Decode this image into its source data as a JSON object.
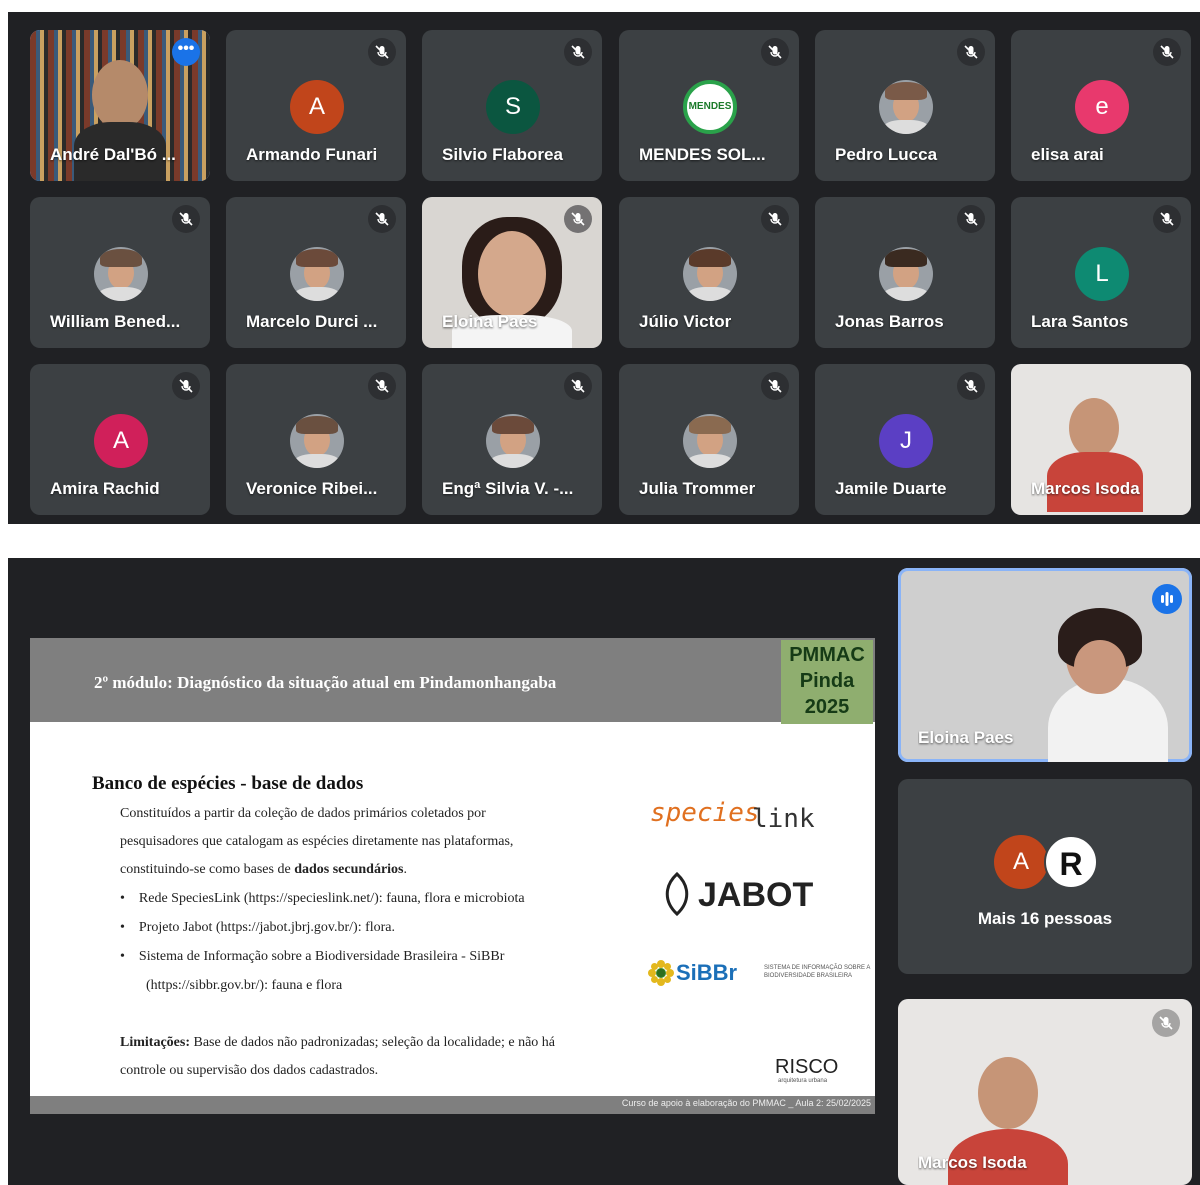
{
  "grid": {
    "tiles": [
      {
        "name": "André Dal'Bó ...",
        "type": "video",
        "active": true
      },
      {
        "name": "Armando Funari",
        "type": "avatar",
        "initial": "A",
        "color": "#c1451b"
      },
      {
        "name": "Silvio Flaborea",
        "type": "avatar",
        "initial": "S",
        "color": "#0b5640"
      },
      {
        "name": "MENDES SOL...",
        "type": "logo",
        "logo_text": "MENDES"
      },
      {
        "name": "Pedro Lucca",
        "type": "photo"
      },
      {
        "name": "elisa arai",
        "type": "avatar",
        "initial": "e",
        "color": "#e8396d"
      },
      {
        "name": "William Bened...",
        "type": "photo"
      },
      {
        "name": "Marcelo Durci ...",
        "type": "photo"
      },
      {
        "name": "Eloina Paes",
        "type": "video"
      },
      {
        "name": "Júlio Victor",
        "type": "photo"
      },
      {
        "name": "Jonas Barros",
        "type": "photo"
      },
      {
        "name": "Lara Santos",
        "type": "avatar",
        "initial": "L",
        "color": "#0e8a72"
      },
      {
        "name": "Amira Rachid",
        "type": "avatar",
        "initial": "A",
        "color": "#d0205a"
      },
      {
        "name": "Veronice Ribei...",
        "type": "photo"
      },
      {
        "name": "Engª Silvia V. -...",
        "type": "photo"
      },
      {
        "name": "Julia Trommer",
        "type": "photo"
      },
      {
        "name": "Jamile Duarte",
        "type": "avatar",
        "initial": "J",
        "color": "#5b3fc4"
      },
      {
        "name": "Marcos Isoda",
        "type": "video"
      }
    ]
  },
  "slide": {
    "title": "2º módulo: Diagnóstico da situação atual em Pindamonhangaba",
    "badge_line1": "PMMAC",
    "badge_line2": "Pinda",
    "badge_line3": "2025",
    "heading": "Banco de espécies - base de dados",
    "intro_line1": "Constituídos a partir da coleção de dados primários coletados por",
    "intro_line2": "pesquisadores que catalogam as espécies diretamente nas plataformas,",
    "intro_line3_a": "constituindo-se como bases de ",
    "intro_line3_b": "dados secundários",
    "intro_line3_c": ".",
    "bullet1": "Rede SpeciesLink (https://specieslink.net/): fauna, flora e microbiota",
    "bullet2": "Projeto Jabot (https://jabot.jbrj.gov.br/): flora.",
    "bullet3_line1": "Sistema de Informação sobre a Biodiversidade Brasileira - SiBBr",
    "bullet3_line2": "(https://sibbr.gov.br/): fauna e flora",
    "limit_label": "Limitações:",
    "limit_line1": " Base de dados não padronizadas; seleção da localidade; e não há",
    "limit_line2": "controle ou supervisão dos dados cadastrados.",
    "logo_species": "species",
    "logo_link": "link",
    "logo_jabot": "JABOT",
    "logo_sibbr": "SiBBr",
    "logo_sibbr_sub": "SISTEMA DE INFORMAÇÃO SOBRE A BIODIVERSIDADE BRASILEIRA",
    "logo_risco": "RISCO",
    "logo_risco_sub": "arquitetura urbana",
    "footer": "Curso de apoio à elaboração do PMMAC _ Aula 2: 25/02/2025"
  },
  "side": {
    "speaker_name": "Eloina Paes",
    "more_label": "Mais 16 pessoas",
    "more_initial_1": "A",
    "more_initial_2": "R",
    "bottom_name": "Marcos Isoda"
  },
  "colors": {
    "panel_bg": "#202124",
    "tile_bg": "#3c4043",
    "active_outline": "#8ab4f8",
    "speaking_badge": "#1a73e8"
  }
}
